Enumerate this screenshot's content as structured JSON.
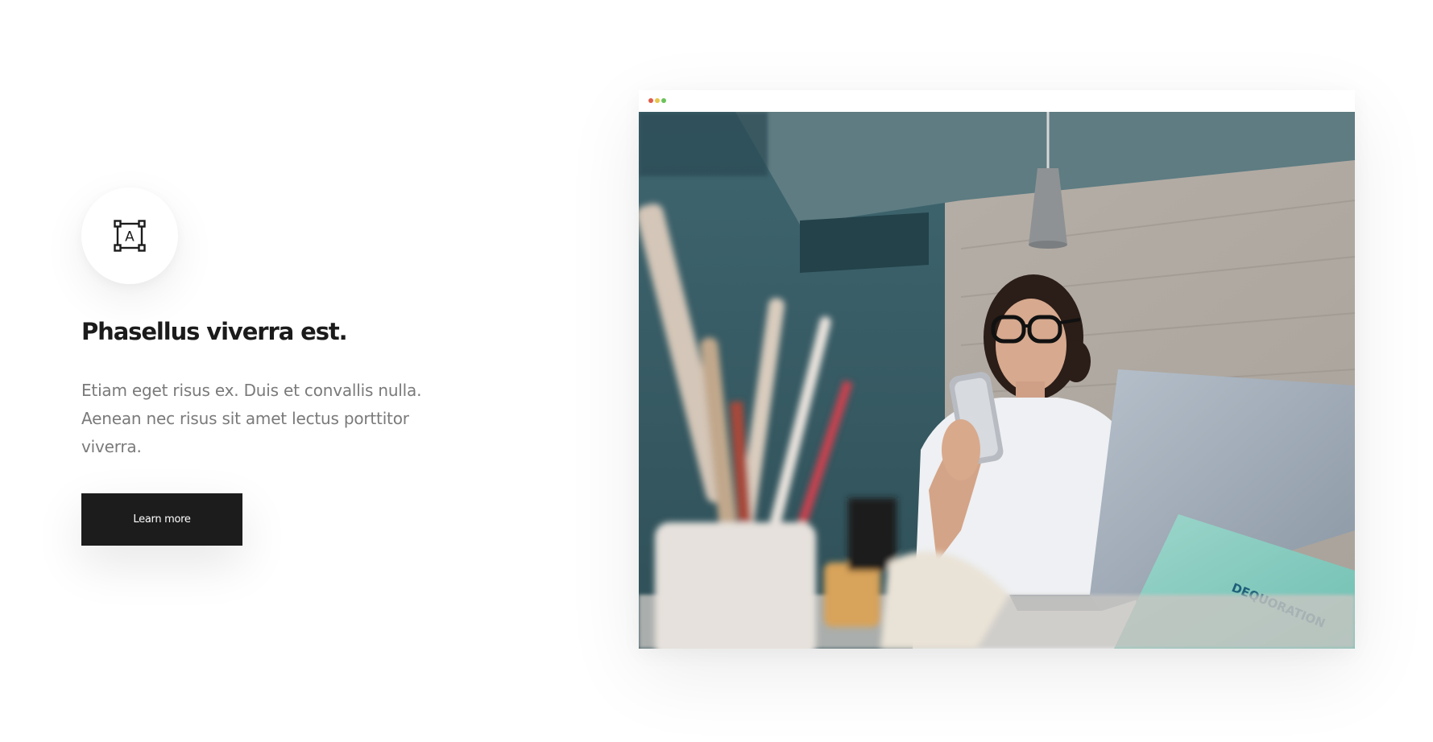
{
  "feature": {
    "icon": "text-frame-icon",
    "icon_letter": "A",
    "title": "Phasellus viverra est.",
    "description": "Etiam eget risus ex. Duis et convallis nulla. Aenean nec risus sit amet lectus porttitor viverra.",
    "button_label": "Learn more"
  },
  "browser_mockup": {
    "window_controls": [
      "close-dot",
      "minimize-dot",
      "maximize-dot"
    ],
    "image_subject": "woman with glasses using a smartphone at a desk with a laptop and paint brushes",
    "laptop_sticker_text": "DEQUORATION"
  },
  "colors": {
    "button_background": "#1c1c1c",
    "title": "#1b1b1b",
    "body_text": "#7a7a7a",
    "dot_red": "#e05c4a",
    "dot_yellow": "#e8c64a",
    "dot_green": "#6cc25a"
  }
}
